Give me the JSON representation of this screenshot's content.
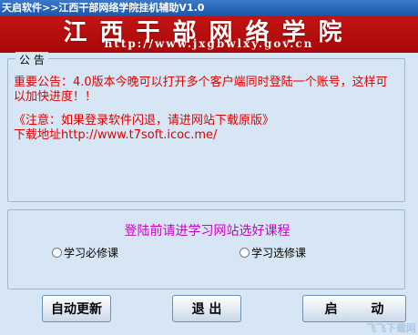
{
  "window": {
    "title": "天启软件>>江西干部网络学院挂机辅助V1.0"
  },
  "banner": {
    "title": "江西干部网络学院",
    "url": "http://www.jxgbwlxy.gov.cn"
  },
  "notice": {
    "legend": "公 告",
    "main_text": "重要公告：4.0版本今晚可以打开多个客户端同时登陆一个账号，这样可以加快进度！！",
    "warning_text": "《注意：如果登录软件闪退，请进网站下载原版》",
    "download_text": "下载地址http://www.t7soft.icoc.me/",
    "color": "#e00000"
  },
  "course": {
    "prompt": "登陆前请进学习网站选好课程",
    "prompt_color": "#cc00cc",
    "options": [
      {
        "label": "学习必修课",
        "selected": false
      },
      {
        "label": "学习选修课",
        "selected": false
      }
    ]
  },
  "buttons": {
    "auto_update": "自动更新",
    "exit": "退 出",
    "start": "启 动"
  },
  "watermark": {
    "text": "飞飞下载网"
  }
}
